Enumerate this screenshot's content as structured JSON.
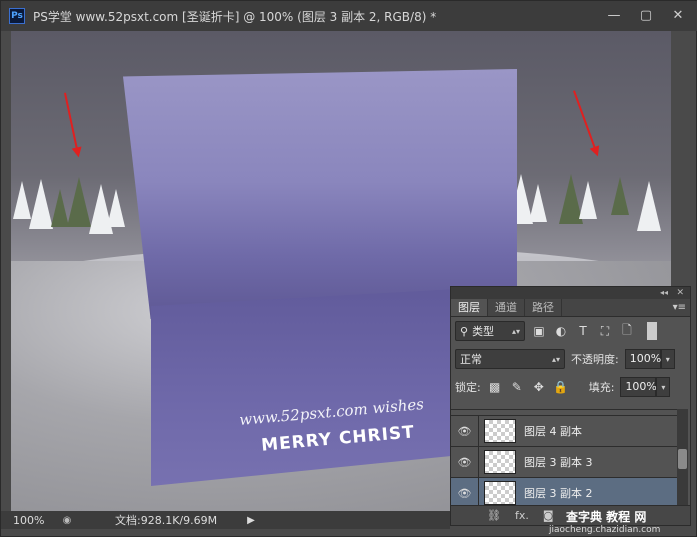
{
  "window": {
    "title": "PS学堂 www.52psxt.com [圣诞折卡] @ 100% (图层 3 副本 2, RGB/8) *",
    "app_logo": "Ps",
    "buttons": [
      "—",
      "▢",
      "✕"
    ]
  },
  "canvas": {
    "card_url": "www.52psxt.com  wishes",
    "card_greeting": "MERRY CHRIST"
  },
  "layers_panel": {
    "tabs": [
      "图层",
      "通道",
      "路径"
    ],
    "filter_kind": "类型",
    "blend_mode": "正常",
    "opacity_label": "不透明度:",
    "opacity_value": "100%",
    "lock_label": "锁定:",
    "fill_label": "填充:",
    "fill_value": "100%",
    "layers": [
      {
        "name": "图层 4 副本",
        "selected": false
      },
      {
        "name": "图层 3 副本 3",
        "selected": false
      },
      {
        "name": "图层 3 副本 2",
        "selected": true
      }
    ],
    "footer_icons": [
      "link-icon",
      "fx-icon",
      "mask-icon"
    ],
    "fx_label": "fx."
  },
  "status_bar": {
    "zoom": "100%",
    "doc_info": "文档:928.1K/9.69M"
  },
  "watermark": {
    "text": "查字典 教程 网",
    "url": "jiaocheng.chazidian.com"
  }
}
